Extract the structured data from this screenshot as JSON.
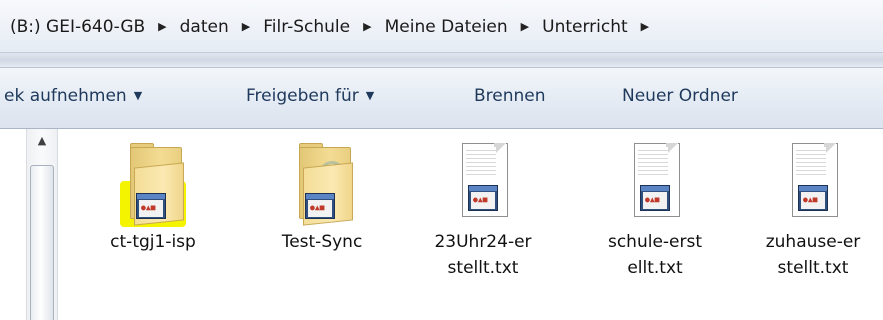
{
  "address": {
    "crumbs": [
      "(B:) GEI-640-GB",
      "daten",
      "Filr-Schule",
      "Meine Dateien",
      "Unterricht"
    ],
    "separator": "▶"
  },
  "toolbar": {
    "item1": "ek aufnehmen",
    "item2": "Freigeben für",
    "item3": "Brennen",
    "item4": "Neuer Ordner",
    "caret": "▼"
  },
  "scrollbar": {
    "up_arrow": "▲"
  },
  "files": [
    {
      "name": "ct-tgj1-isp",
      "type": "folder",
      "highlighted": true
    },
    {
      "name": "Test-Sync",
      "type": "folder"
    },
    {
      "name_line1": "23Uhr24-er",
      "name_line2": "stellt.txt",
      "type": "txt"
    },
    {
      "name_line1": "schule-erst",
      "name_line2": "ellt.txt",
      "type": "txt"
    },
    {
      "name_line1": "zuhause-er",
      "name_line2": "stellt.txt",
      "type": "txt"
    }
  ],
  "colors": {
    "toolbar_text": "#1e395b",
    "highlight": "#f4f400",
    "folder": "#f3dc93"
  }
}
